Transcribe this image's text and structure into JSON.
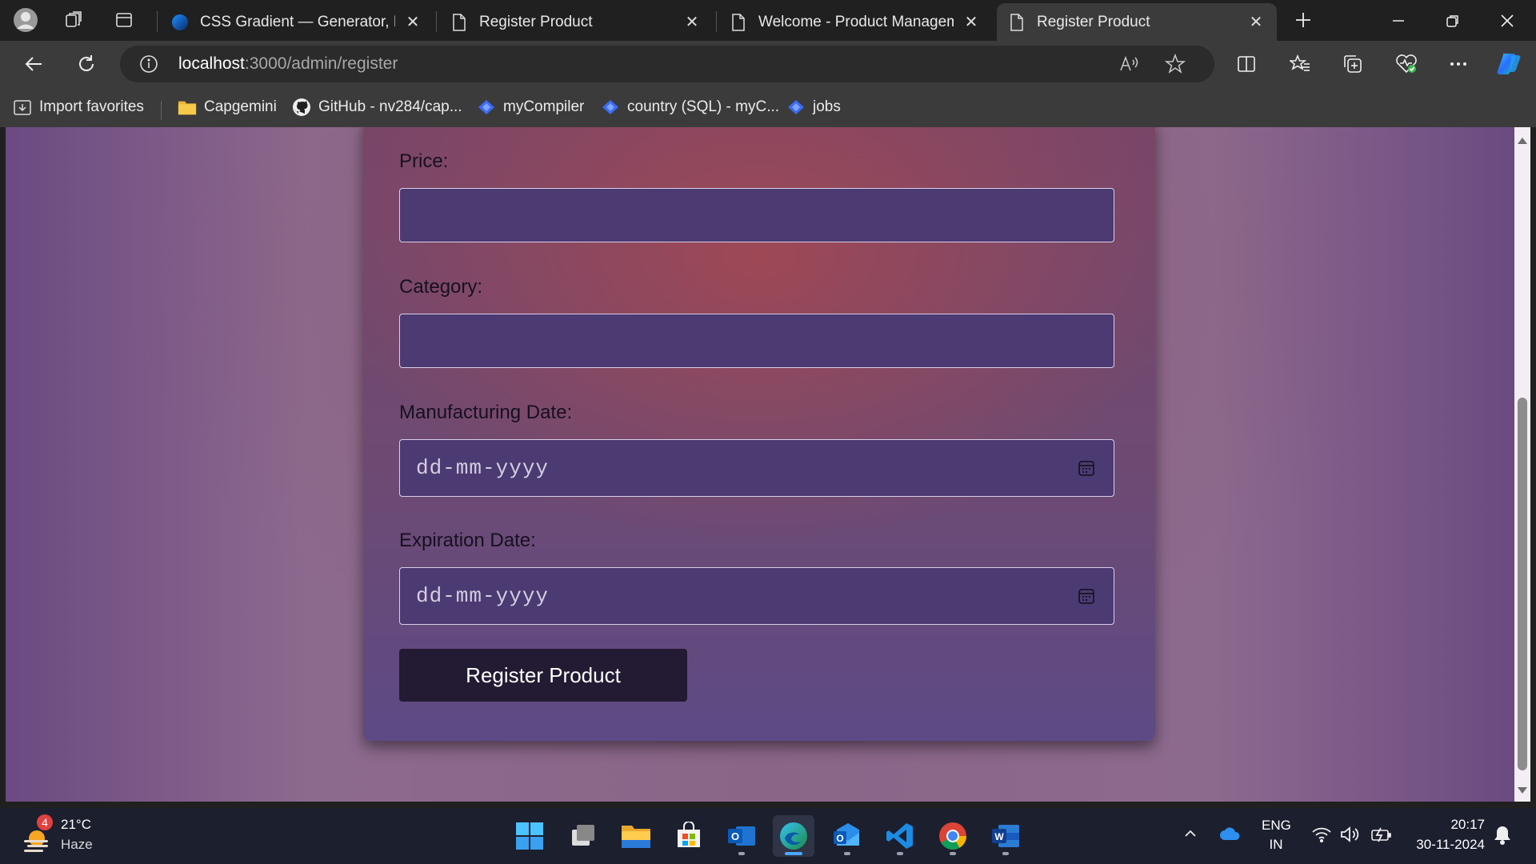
{
  "browser": {
    "tabs": [
      {
        "title": "CSS Gradient — Generator, Maker, and Library",
        "icon": "css-gradient-icon",
        "active": false
      },
      {
        "title": "Register Product",
        "icon": "page-icon",
        "active": false
      },
      {
        "title": "Welcome - Product Management",
        "icon": "page-icon",
        "active": false
      },
      {
        "title": "Register Product",
        "icon": "page-icon",
        "active": true
      }
    ],
    "address": {
      "host": "localhost",
      "path": ":3000/admin/register"
    },
    "favorites": [
      {
        "label": "Import favorites",
        "icon": "import-icon"
      },
      {
        "label": "Capgemini",
        "icon": "folder-icon"
      },
      {
        "label": "GitHub - nv284/cap...",
        "icon": "github-icon"
      },
      {
        "label": "myCompiler",
        "icon": "mycompiler-icon"
      },
      {
        "label": "country (SQL) - myC...",
        "icon": "mycompiler-icon"
      },
      {
        "label": "jobs",
        "icon": "mycompiler-icon"
      }
    ]
  },
  "form": {
    "price_label": "Price:",
    "category_label": "Category:",
    "mfg_label": "Manufacturing Date:",
    "mfg_placeholder": "dd-mm-yyyy",
    "exp_label": "Expiration Date:",
    "exp_placeholder": "dd-mm-yyyy",
    "submit_label": "Register Product"
  },
  "taskbar": {
    "weather": {
      "temp": "21°C",
      "condition": "Haze",
      "badge": "4"
    },
    "language": {
      "line1": "ENG",
      "line2": "IN"
    },
    "time": "20:17",
    "date": "30-11-2024"
  }
}
